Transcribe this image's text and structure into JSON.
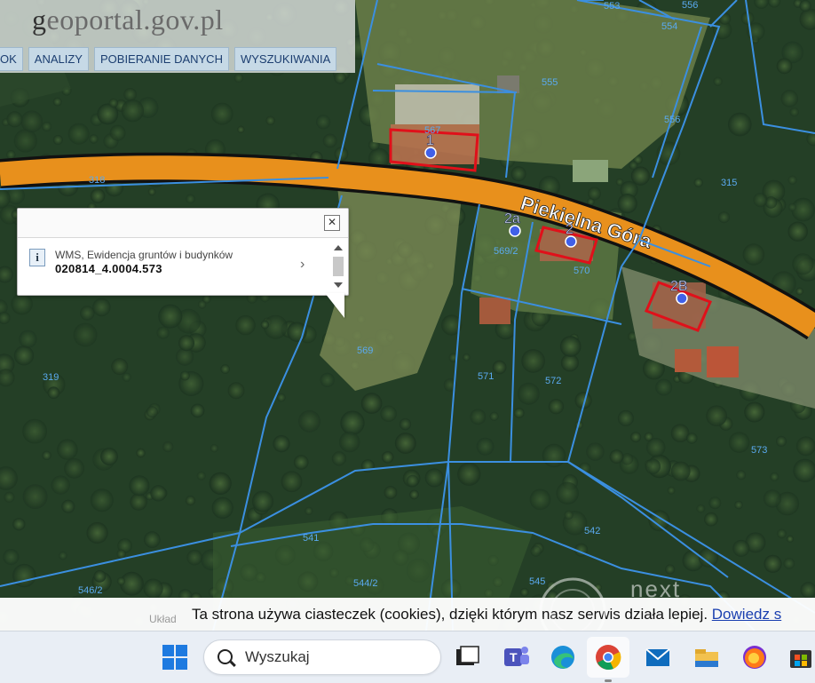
{
  "header": {
    "logo_prefix": "g",
    "logo_main": "eoportal.gov.pl",
    "menu": [
      "OK",
      "ANALIZY",
      "POBIERANIE DANYCH",
      "WYSZUKIWANIA"
    ]
  },
  "map": {
    "road_name": "Piekielna Góra",
    "parcel_labels": [
      "553",
      "554",
      "556",
      "555",
      "556",
      "315",
      "318",
      "319",
      "569/2",
      "569",
      "570",
      "571",
      "572",
      "573",
      "541",
      "542",
      "544/2",
      "545",
      "546/2"
    ],
    "building_labels": [
      "1",
      "2",
      "2a",
      "2B",
      "567"
    ],
    "colors": {
      "parcel_line": "#3b8fe0",
      "road": "#e8901c",
      "building": "#e0101a",
      "parcel_text": "#5aaaf0"
    }
  },
  "popup": {
    "source": "WMS, Ewidencja gruntów i budynków",
    "parcel_id": "020814_4.0004.573",
    "close_icon": "close-icon",
    "info_icon": "i"
  },
  "cookie_bar": {
    "text": "Ta strona używa ciasteczek (cookies), dzięki którym nasz serwis działa lepiej.",
    "link": "Dowiedz s"
  },
  "coord_label": "Układ",
  "watermark": "next",
  "taskbar": {
    "search_placeholder": "Wyszukaj",
    "apps": [
      "start-icon",
      "task-view-icon",
      "teams-icon",
      "edge-icon",
      "chrome-icon",
      "mail-icon",
      "file-explorer-icon",
      "firefox-icon",
      "store-icon"
    ]
  }
}
